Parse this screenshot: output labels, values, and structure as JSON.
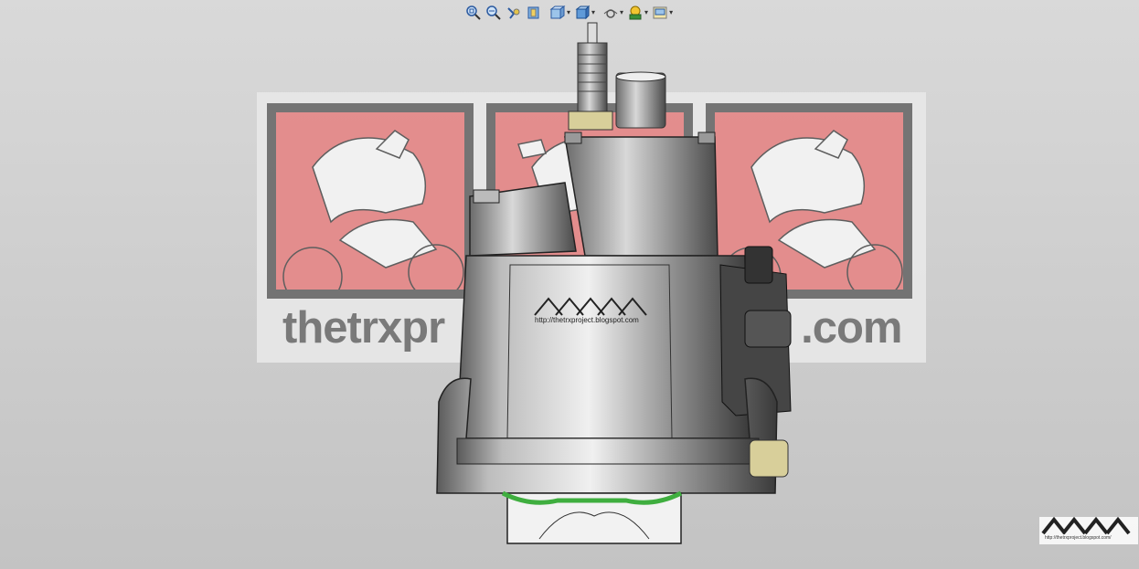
{
  "toolbar": {
    "buttons": [
      {
        "name": "zoom-to-fit-icon",
        "dropdown": false
      },
      {
        "name": "zoom-to-area-icon",
        "dropdown": false
      },
      {
        "name": "previous-view-icon",
        "dropdown": false
      },
      {
        "name": "section-view-icon",
        "dropdown": false
      },
      {
        "name": "view-orientation-icon",
        "dropdown": true
      },
      {
        "name": "display-style-icon",
        "dropdown": true
      },
      {
        "name": "hide-show-items-icon",
        "dropdown": true
      },
      {
        "name": "edit-appearance-icon",
        "dropdown": true
      },
      {
        "name": "apply-scene-icon",
        "dropdown": true
      }
    ],
    "caret": "▾"
  },
  "decal": {
    "left_text": "thetrxpr",
    "right_text": ".com",
    "colors": {
      "panel": "#e58888",
      "frame": "#6c6c6c",
      "text": "#737373"
    }
  },
  "engine": {
    "logo_url": "http://thetrxproject.blogspot.com",
    "colors": {
      "body": "#8a8a8a",
      "dark": "#3c3c3c",
      "highlight": "#f2f2f2",
      "brass": "#d8cf9a",
      "green": "#3fae3f"
    }
  },
  "watermark": {
    "url": "http://thetrxproject.blogspot.com/"
  }
}
